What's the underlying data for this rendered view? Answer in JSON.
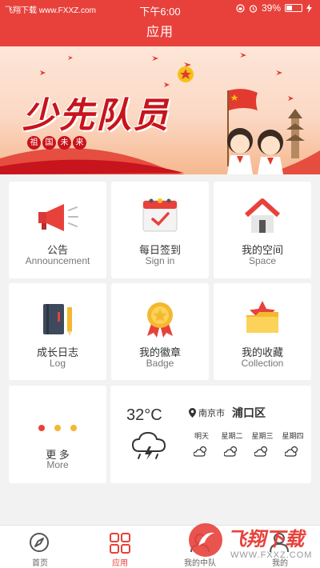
{
  "status_bar": {
    "source_label": "飞翔下载 www.FXXZ.com",
    "time": "下午6:00",
    "battery": "39%",
    "battery_level": 0.39
  },
  "header": {
    "title": "应用"
  },
  "banner": {
    "title": "少先队员",
    "subtitle_chars": [
      "祖",
      "国",
      "未",
      "来"
    ]
  },
  "grid": {
    "announcement": {
      "zh": "公告",
      "en": "Announcement",
      "icon": "megaphone-icon"
    },
    "sign_in": {
      "zh": "每日签到",
      "en": "Sign in",
      "icon": "calendar-check-icon"
    },
    "space": {
      "zh": "我的空间",
      "en": "Space",
      "icon": "house-icon"
    },
    "log": {
      "zh": "成长日志",
      "en": "Log",
      "icon": "notebook-pencil-icon"
    },
    "badge": {
      "zh": "我的徽章",
      "en": "Badge",
      "icon": "medal-icon"
    },
    "collection": {
      "zh": "我的收藏",
      "en": "Collection",
      "icon": "star-folder-icon"
    },
    "more": {
      "zh": "更 多",
      "en": "More",
      "icon": "dots-icon"
    }
  },
  "weather": {
    "temperature": "32°C",
    "city": "南京市",
    "district": "浦口区",
    "days": [
      "明天",
      "星期二",
      "星期三",
      "星期四"
    ]
  },
  "tabs": [
    {
      "label": "首页",
      "icon": "compass-icon"
    },
    {
      "label": "应用",
      "icon": "grid-icon"
    },
    {
      "label": "我的中队",
      "icon": "team-icon"
    },
    {
      "label": "我的",
      "icon": "person-icon"
    }
  ],
  "watermark": {
    "title": "飞翔下载",
    "url": "WWW.FXXZ.COM"
  },
  "colors": {
    "accent": "#e8413b",
    "background": "#f2f2f2"
  }
}
